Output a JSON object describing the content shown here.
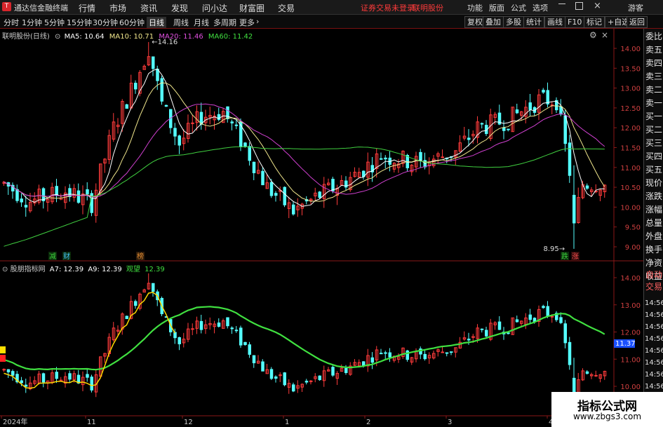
{
  "app": {
    "title": "通达信金融终端",
    "menus": [
      "行情",
      "市场",
      "资讯",
      "发现",
      "问小达",
      "财富圈",
      "交易"
    ],
    "status": "证券交易未登录",
    "stock_link": "联明股份",
    "right_menus": [
      "功能",
      "版面",
      "公式",
      "选项"
    ],
    "guest": "游客"
  },
  "periods": [
    "分时",
    "1分钟",
    "5分钟",
    "15分钟",
    "30分钟",
    "60分钟",
    "日线",
    "周线",
    "月线",
    "多周期",
    "更多"
  ],
  "active_period": "日线",
  "toolbar_right": [
    "复权",
    "叠加",
    "多股",
    "统计",
    "画线",
    "F10",
    "标记",
    "+自选",
    "返回"
  ],
  "side": [
    "委比",
    "卖五",
    "卖四",
    "卖三",
    "卖二",
    "卖一",
    "买一",
    "买二",
    "买三",
    "买四",
    "买五",
    "现价",
    "涨跌",
    "涨幅",
    "总量",
    "外盘",
    "换手",
    "净资",
    "收益"
  ],
  "side_lower": [
    "自动",
    "交易"
  ],
  "main_legend": {
    "name": "联明股份(日线)",
    "ma5": "MA5: 10.64",
    "ma10": "MA10: 10.71",
    "ma20": "MA20: 11.46",
    "ma60": "MA60: 11.42"
  },
  "high_label": "14.16",
  "low_label": "8.95",
  "main_yticks": [
    "14.00",
    "13.50",
    "13.00",
    "12.50",
    "12.00",
    "11.50",
    "11.00",
    "10.50",
    "10.00",
    "9.50",
    "9.00"
  ],
  "event_marks": [
    {
      "text": "减",
      "color": "#3cd23c"
    },
    {
      "text": "财",
      "color": "#46c8ff"
    },
    {
      "text": "榜",
      "color": "#e08a30"
    },
    {
      "text": "跌",
      "color": "#3cd23c"
    },
    {
      "text": "涨",
      "color": "#ff5050"
    }
  ],
  "sub_legend": {
    "name": "股朋指标网",
    "a7": "A7: 12.39",
    "a9": "A9: 12.39",
    "watch": "观望",
    "watch_val": "12.39"
  },
  "sub_yticks": [
    "14.00",
    "13.00",
    "12.00",
    "11.00",
    "10.00"
  ],
  "sub_marker": "11.37",
  "side_times": [
    "14:56",
    "14:56",
    "14:56",
    "14:56",
    "14:56",
    "14:56",
    "14:56",
    "14:56"
  ],
  "dates": [
    "2024年",
    "11",
    "12",
    "1",
    "2",
    "3",
    "4"
  ],
  "watermark": {
    "line1": "指标公式网",
    "line2": "www.zbgs3.com"
  },
  "colors": {
    "up": "#ff3b3b",
    "down": "#54ffff",
    "ma5": "#ffffff",
    "ma10": "#f0e68c",
    "ma20": "#d040d0",
    "ma60": "#40d040",
    "green": "#40e040",
    "yellow": "#ffd700"
  }
}
